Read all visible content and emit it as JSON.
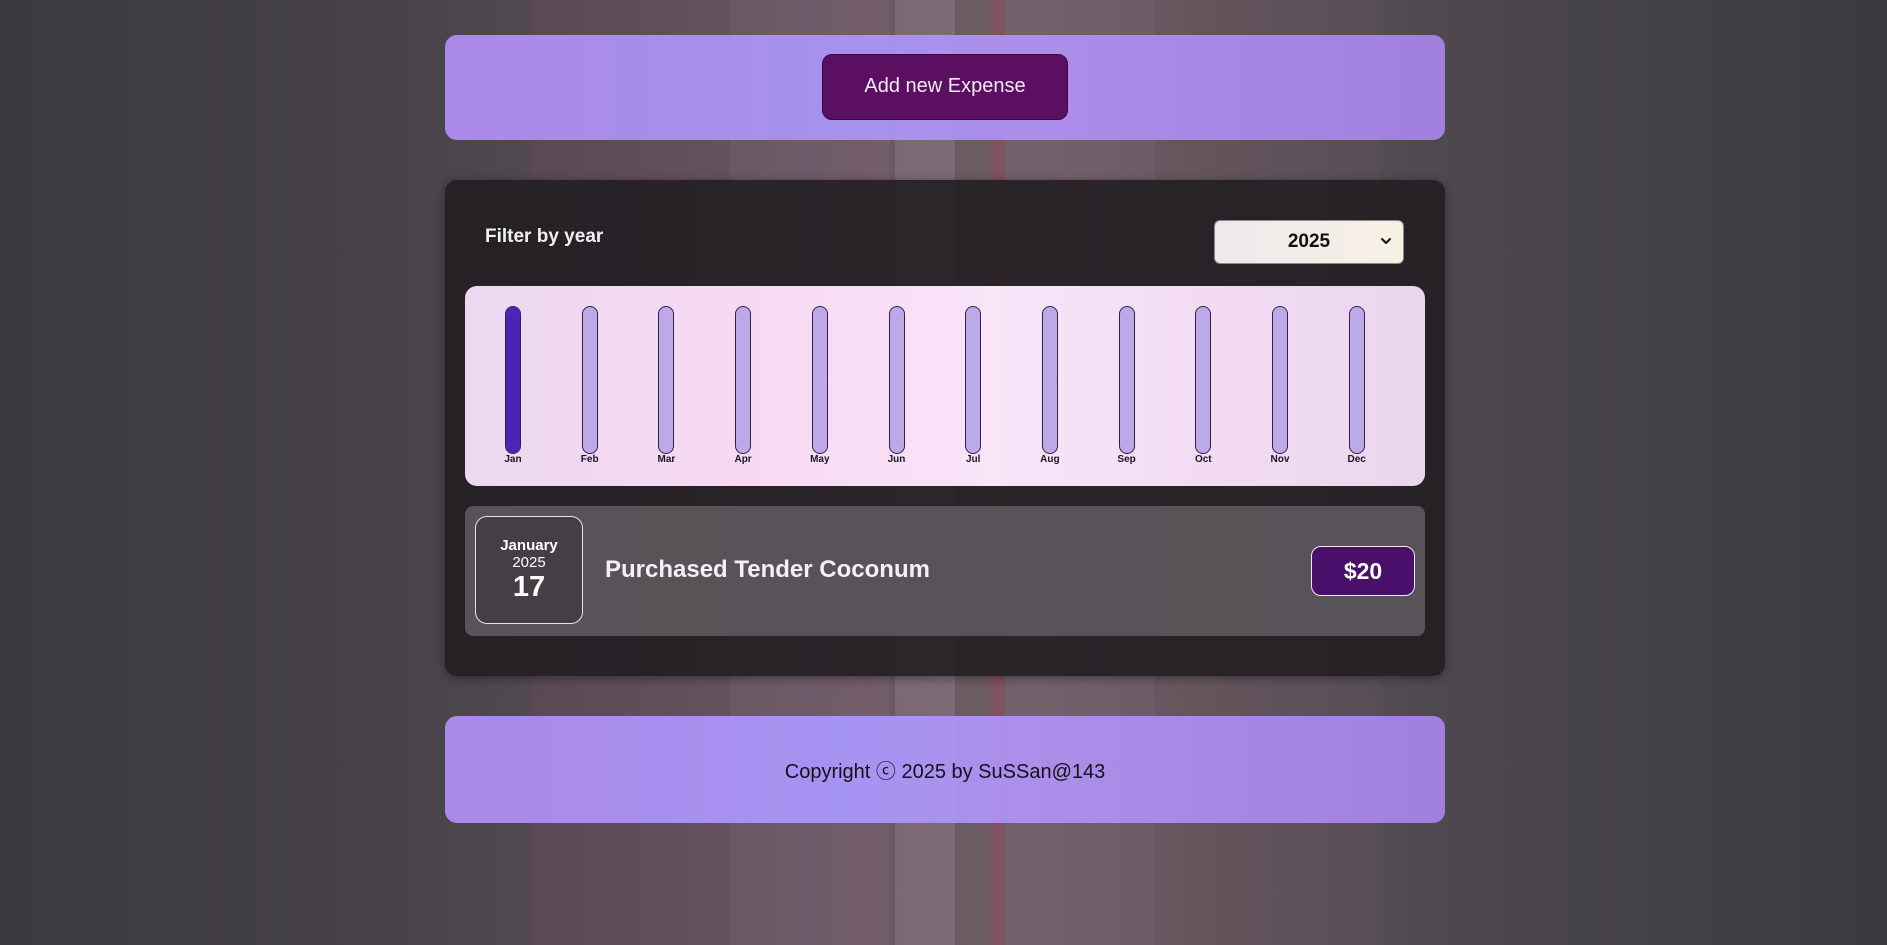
{
  "header": {
    "add_button_label": "Add new Expense"
  },
  "filter": {
    "label": "Filter by year",
    "selected_year": "2025"
  },
  "chart_data": {
    "type": "bar",
    "categories": [
      "Jan",
      "Feb",
      "Mar",
      "Apr",
      "May",
      "Jun",
      "Jul",
      "Aug",
      "Sep",
      "Oct",
      "Nov",
      "Dec"
    ],
    "values": [
      20,
      0,
      0,
      0,
      0,
      0,
      0,
      0,
      0,
      0,
      0,
      0
    ],
    "max": 20,
    "colors": {
      "fill": "#4b23b5",
      "empty": "#bea9e8"
    }
  },
  "expenses": [
    {
      "month": "January",
      "year": "2025",
      "day": "17",
      "title": "Purchased Tender Coconum",
      "amount": "$20"
    }
  ],
  "footer": {
    "copyright": "Copyright ⓒ 2025 by SuSSan@143"
  },
  "colors": {
    "accent": "#5a0f61",
    "amount_badge": "#4a0f6a"
  }
}
